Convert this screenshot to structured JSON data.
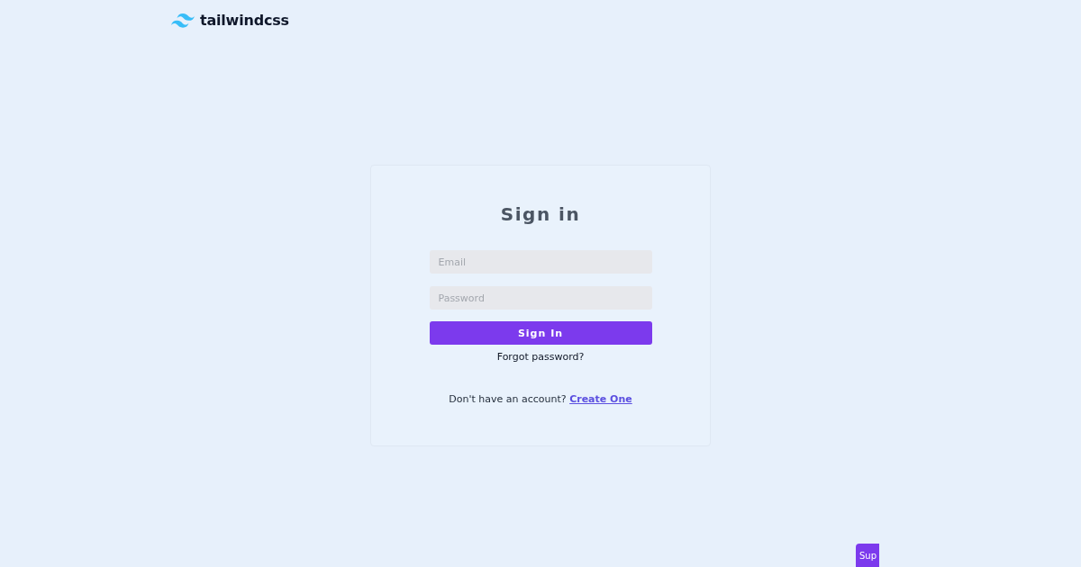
{
  "header": {
    "logo_text": "tailwindcss"
  },
  "form": {
    "title": "Sign in",
    "fields": [
      {
        "placeholder": "Email"
      },
      {
        "placeholder": "Password"
      }
    ],
    "submit": "Sign In",
    "forgot_link": "Forgot password?",
    "signup": {
      "prompt": "Don't have an account?",
      "link": "Create One"
    }
  },
  "support_button": {
    "label": "Sup"
  }
}
